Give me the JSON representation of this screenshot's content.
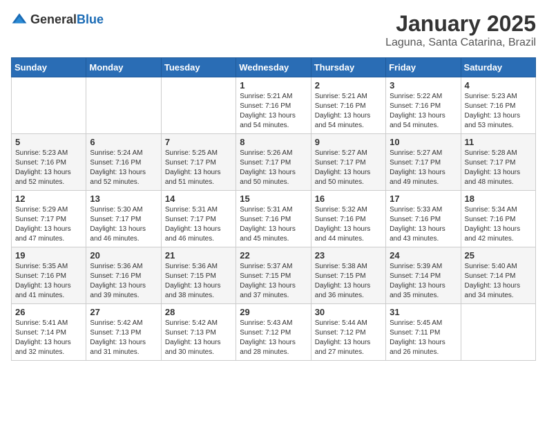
{
  "header": {
    "logo_general": "General",
    "logo_blue": "Blue",
    "title": "January 2025",
    "subtitle": "Laguna, Santa Catarina, Brazil"
  },
  "days_of_week": [
    "Sunday",
    "Monday",
    "Tuesday",
    "Wednesday",
    "Thursday",
    "Friday",
    "Saturday"
  ],
  "weeks": [
    [
      {
        "day": "",
        "info": ""
      },
      {
        "day": "",
        "info": ""
      },
      {
        "day": "",
        "info": ""
      },
      {
        "day": "1",
        "info": "Sunrise: 5:21 AM\nSunset: 7:16 PM\nDaylight: 13 hours\nand 54 minutes."
      },
      {
        "day": "2",
        "info": "Sunrise: 5:21 AM\nSunset: 7:16 PM\nDaylight: 13 hours\nand 54 minutes."
      },
      {
        "day": "3",
        "info": "Sunrise: 5:22 AM\nSunset: 7:16 PM\nDaylight: 13 hours\nand 54 minutes."
      },
      {
        "day": "4",
        "info": "Sunrise: 5:23 AM\nSunset: 7:16 PM\nDaylight: 13 hours\nand 53 minutes."
      }
    ],
    [
      {
        "day": "5",
        "info": "Sunrise: 5:23 AM\nSunset: 7:16 PM\nDaylight: 13 hours\nand 52 minutes."
      },
      {
        "day": "6",
        "info": "Sunrise: 5:24 AM\nSunset: 7:16 PM\nDaylight: 13 hours\nand 52 minutes."
      },
      {
        "day": "7",
        "info": "Sunrise: 5:25 AM\nSunset: 7:17 PM\nDaylight: 13 hours\nand 51 minutes."
      },
      {
        "day": "8",
        "info": "Sunrise: 5:26 AM\nSunset: 7:17 PM\nDaylight: 13 hours\nand 50 minutes."
      },
      {
        "day": "9",
        "info": "Sunrise: 5:27 AM\nSunset: 7:17 PM\nDaylight: 13 hours\nand 50 minutes."
      },
      {
        "day": "10",
        "info": "Sunrise: 5:27 AM\nSunset: 7:17 PM\nDaylight: 13 hours\nand 49 minutes."
      },
      {
        "day": "11",
        "info": "Sunrise: 5:28 AM\nSunset: 7:17 PM\nDaylight: 13 hours\nand 48 minutes."
      }
    ],
    [
      {
        "day": "12",
        "info": "Sunrise: 5:29 AM\nSunset: 7:17 PM\nDaylight: 13 hours\nand 47 minutes."
      },
      {
        "day": "13",
        "info": "Sunrise: 5:30 AM\nSunset: 7:17 PM\nDaylight: 13 hours\nand 46 minutes."
      },
      {
        "day": "14",
        "info": "Sunrise: 5:31 AM\nSunset: 7:17 PM\nDaylight: 13 hours\nand 46 minutes."
      },
      {
        "day": "15",
        "info": "Sunrise: 5:31 AM\nSunset: 7:16 PM\nDaylight: 13 hours\nand 45 minutes."
      },
      {
        "day": "16",
        "info": "Sunrise: 5:32 AM\nSunset: 7:16 PM\nDaylight: 13 hours\nand 44 minutes."
      },
      {
        "day": "17",
        "info": "Sunrise: 5:33 AM\nSunset: 7:16 PM\nDaylight: 13 hours\nand 43 minutes."
      },
      {
        "day": "18",
        "info": "Sunrise: 5:34 AM\nSunset: 7:16 PM\nDaylight: 13 hours\nand 42 minutes."
      }
    ],
    [
      {
        "day": "19",
        "info": "Sunrise: 5:35 AM\nSunset: 7:16 PM\nDaylight: 13 hours\nand 41 minutes."
      },
      {
        "day": "20",
        "info": "Sunrise: 5:36 AM\nSunset: 7:16 PM\nDaylight: 13 hours\nand 39 minutes."
      },
      {
        "day": "21",
        "info": "Sunrise: 5:36 AM\nSunset: 7:15 PM\nDaylight: 13 hours\nand 38 minutes."
      },
      {
        "day": "22",
        "info": "Sunrise: 5:37 AM\nSunset: 7:15 PM\nDaylight: 13 hours\nand 37 minutes."
      },
      {
        "day": "23",
        "info": "Sunrise: 5:38 AM\nSunset: 7:15 PM\nDaylight: 13 hours\nand 36 minutes."
      },
      {
        "day": "24",
        "info": "Sunrise: 5:39 AM\nSunset: 7:14 PM\nDaylight: 13 hours\nand 35 minutes."
      },
      {
        "day": "25",
        "info": "Sunrise: 5:40 AM\nSunset: 7:14 PM\nDaylight: 13 hours\nand 34 minutes."
      }
    ],
    [
      {
        "day": "26",
        "info": "Sunrise: 5:41 AM\nSunset: 7:14 PM\nDaylight: 13 hours\nand 32 minutes."
      },
      {
        "day": "27",
        "info": "Sunrise: 5:42 AM\nSunset: 7:13 PM\nDaylight: 13 hours\nand 31 minutes."
      },
      {
        "day": "28",
        "info": "Sunrise: 5:42 AM\nSunset: 7:13 PM\nDaylight: 13 hours\nand 30 minutes."
      },
      {
        "day": "29",
        "info": "Sunrise: 5:43 AM\nSunset: 7:12 PM\nDaylight: 13 hours\nand 28 minutes."
      },
      {
        "day": "30",
        "info": "Sunrise: 5:44 AM\nSunset: 7:12 PM\nDaylight: 13 hours\nand 27 minutes."
      },
      {
        "day": "31",
        "info": "Sunrise: 5:45 AM\nSunset: 7:11 PM\nDaylight: 13 hours\nand 26 minutes."
      },
      {
        "day": "",
        "info": ""
      }
    ]
  ]
}
